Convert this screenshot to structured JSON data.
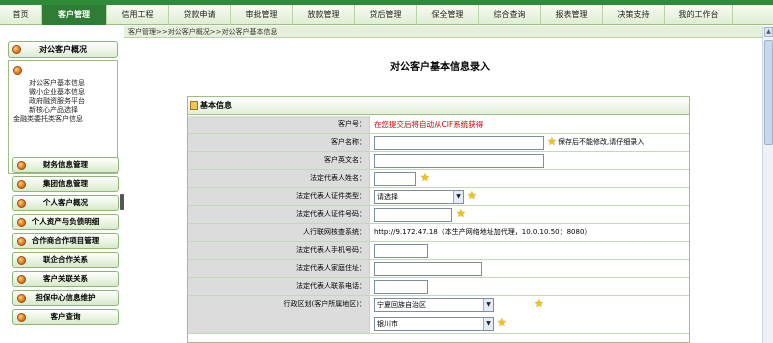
{
  "menu": {
    "tabs": [
      {
        "label": "首页"
      },
      {
        "label": "客户管理",
        "active": true
      },
      {
        "label": "信用工程"
      },
      {
        "label": "贷款申请"
      },
      {
        "label": "审批管理"
      },
      {
        "label": "放款管理"
      },
      {
        "label": "贷后管理"
      },
      {
        "label": "保全管理"
      },
      {
        "label": "综合查询"
      },
      {
        "label": "报表管理"
      },
      {
        "label": "决策支持"
      },
      {
        "label": "我的工作台"
      }
    ]
  },
  "breadcrumb": "客户管理>>对公客户概况>>对公客户基本信息",
  "sidebar": {
    "header": "对公客户概况",
    "sub_items": [
      "对公客户基本信息",
      "微小企业基本信息",
      "政府融资服务平台",
      "新核心产品选择",
      "金融类委托类客户信息"
    ],
    "items": [
      "财务信息管理",
      "集团信息管理",
      "个人客户概况",
      "个人资产与负债明细",
      "合作商合作项目管理",
      "联企合作关系",
      "客户关联关系",
      "担保中心信息维护",
      "客户查询"
    ]
  },
  "page": {
    "title": "对公客户基本信息录入",
    "section_title": "基本信息"
  },
  "form": {
    "rows": [
      {
        "label": "客户号：",
        "note": "在您提交后将自动从CIF系统获得"
      },
      {
        "label": "客户名称：",
        "hint": "保存后不能修改,请仔细录入"
      },
      {
        "label": "客户英文名："
      },
      {
        "label": "法定代表人姓名："
      },
      {
        "label": "法定代表人证件类型：",
        "select_value": "请选择"
      },
      {
        "label": "法定代表人证件号码："
      },
      {
        "label": "人行联网核查系统：",
        "text": "http://9.172.47.18（本生产网络地址加代理，10.0.10.50：8080）"
      },
      {
        "label": "法定代表人手机号码："
      },
      {
        "label": "法定代表人家庭住址："
      },
      {
        "label": "法定代表人联系电话："
      },
      {
        "label": "行政区划(客户所属地区)：",
        "select_value": "宁夏回族自治区",
        "select_value2": "银川市"
      }
    ]
  },
  "icons": {
    "required_star": "star-icon",
    "dropdown_arrow": "chevron-down-icon"
  },
  "colors": {
    "active_tab": "#2f7d34",
    "note_red": "#cc0000",
    "label_bg": "#dcdcdc",
    "star": "#f1c40f"
  }
}
